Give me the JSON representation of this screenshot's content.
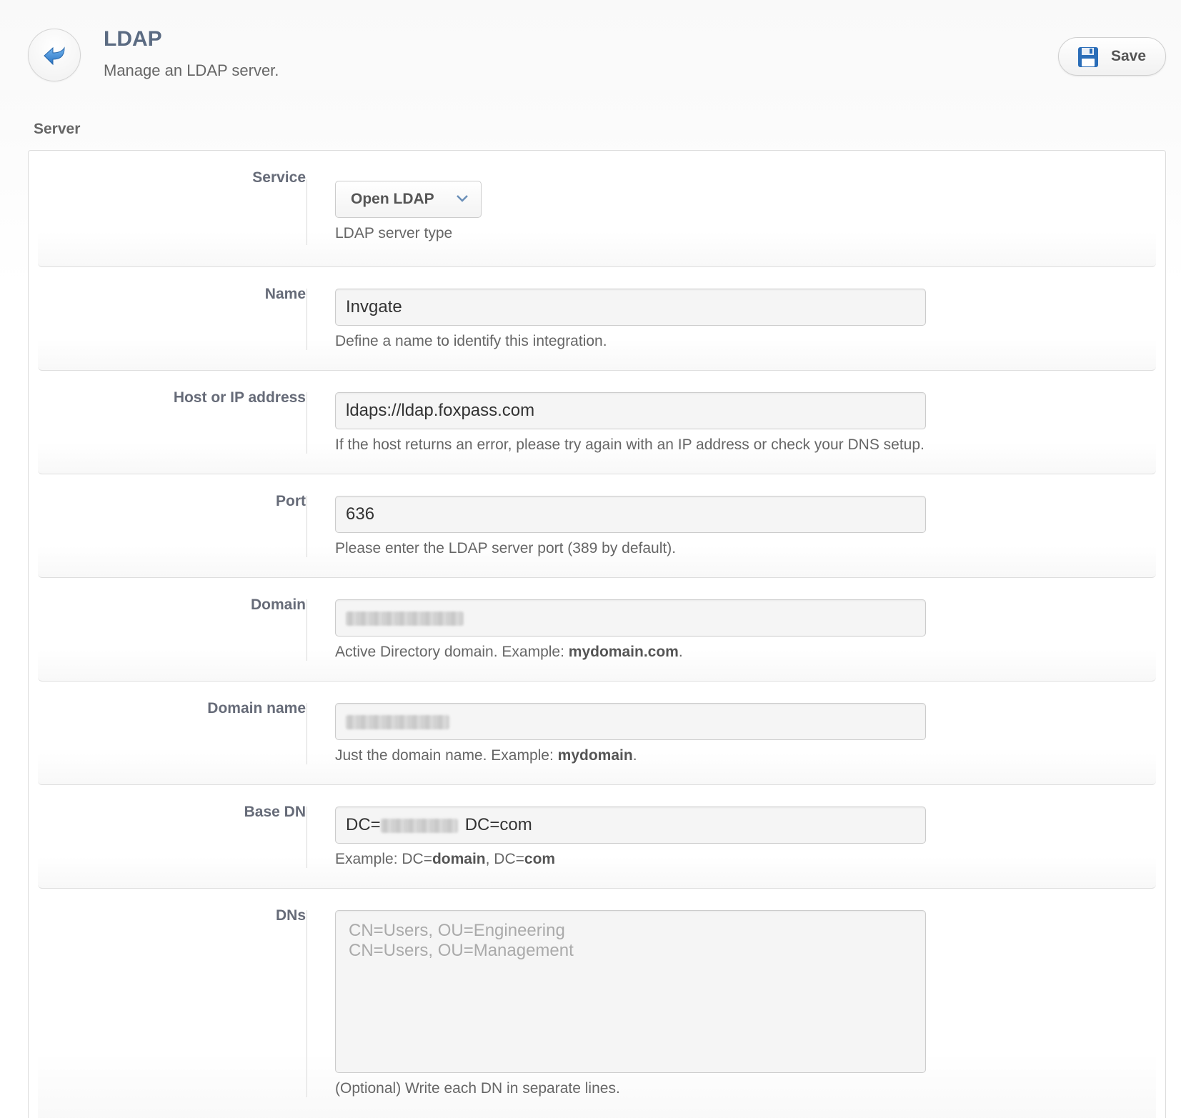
{
  "header": {
    "title": "LDAP",
    "subtitle": "Manage an LDAP server.",
    "back_icon": "back-arrow-icon",
    "save_label": "Save",
    "save_icon": "floppy-disk-icon"
  },
  "section": {
    "title": "Server"
  },
  "fields": {
    "service": {
      "label": "Service",
      "value": "Open LDAP",
      "help": "LDAP server type"
    },
    "name": {
      "label": "Name",
      "value": "Invgate",
      "help": "Define a name to identify this integration."
    },
    "host": {
      "label": "Host or IP address",
      "value": "ldaps://ldap.foxpass.com",
      "help": "If the host returns an error, please try again with an IP address or check your DNS setup."
    },
    "port": {
      "label": "Port",
      "value": "636",
      "help": "Please enter the LDAP server port (389 by default)."
    },
    "domain": {
      "label": "Domain",
      "help_prefix": "Active Directory domain. Example: ",
      "help_bold": "mydomain.com",
      "help_suffix": "."
    },
    "domain_name": {
      "label": "Domain name",
      "help_prefix": "Just the domain name. Example: ",
      "help_bold": "mydomain",
      "help_suffix": "."
    },
    "base_dn": {
      "label": "Base DN",
      "value_prefix": "DC=",
      "value_suffix": "DC=com",
      "help_prefix": "Example: DC=",
      "help_bold_1": "domain",
      "help_middle": ", DC=",
      "help_bold_2": "com"
    },
    "dns": {
      "label": "DNs",
      "placeholder": "CN=Users, OU=Engineering\nCN=Users, OU=Management",
      "help": "(Optional) Write each DN in separate lines."
    }
  },
  "colors": {
    "title": "#5b6b82",
    "save_icon": "#2a6db8",
    "back_arrow": "#3a87d4"
  }
}
